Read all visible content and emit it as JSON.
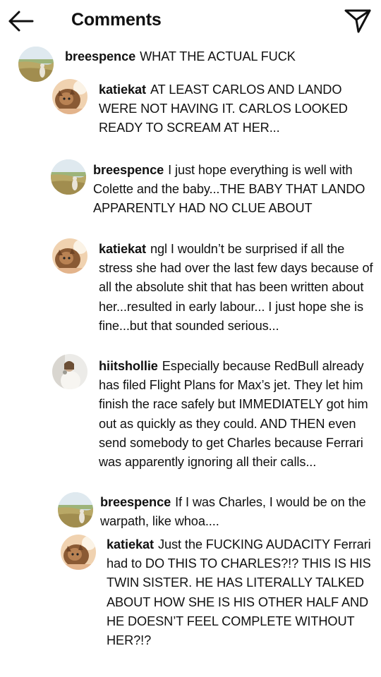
{
  "header": {
    "title": "Comments",
    "back_icon": "arrow-left-icon",
    "send_icon": "paper-plane-icon"
  },
  "comments": [
    {
      "user": "breespence",
      "text": "WHAT THE ACTUAL FUCK",
      "avatar": "landscape-avatar"
    },
    {
      "user": "katiekat",
      "text": "AT LEAST CARLOS AND LANDO WERE NOT HAVING IT. CARLOS LOOKED READY TO SCREAM AT HER...",
      "avatar": "cat-avatar"
    },
    {
      "user": "breespence",
      "text": "I just hope everything is well with Colette and the baby...THE BABY THAT LANDO APPARENTLY HAD NO CLUE ABOUT",
      "avatar": "landscape-avatar"
    },
    {
      "user": "katiekat",
      "text": "ngl I wouldn’t be surprised if all the stress she had over the last few days because of all the absolute shit that has been written about her...resulted in early labour... I just hope she is fine...but that sounded serious...",
      "avatar": "cat-avatar"
    },
    {
      "user": "hiitshollie",
      "text": "Especially because RedBull already has filed Flight Plans for Max’s jet. They let him finish the race safely but IMMEDIATELY got him out as quickly as they could. AND THEN even send somebody to get Charles because Ferrari was apparently ignoring all their calls...",
      "avatar": "person-avatar"
    },
    {
      "user": "breespence",
      "text": "If I was Charles, I would be on the warpath, like whoa....",
      "avatar": "landscape-avatar"
    },
    {
      "user": "katiekat",
      "text": "Just the FUCKING AUDACITY Ferrari had to DO THIS TO CHARLES?!? THIS IS HIS TWIN SISTER. HE HAS LITERALLY TALKED ABOUT HOW SHE IS HIS OTHER HALF AND HE DOESN’T FEEL COMPLETE WITHOUT HER?!?",
      "avatar": "cat-avatar"
    }
  ]
}
